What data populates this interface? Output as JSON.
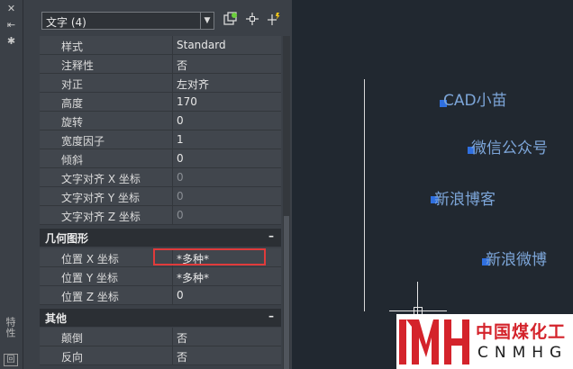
{
  "palette": {
    "close_glyph": "✕",
    "autohide_glyph": "⇤",
    "settings_glyph": "✱",
    "vertical_title": "特性"
  },
  "panel": {
    "selector": "文字 (4)",
    "rows": [
      {
        "label": "样式",
        "value": "Standard"
      },
      {
        "label": "注释性",
        "value": "否"
      },
      {
        "label": "对正",
        "value": "左对齐"
      },
      {
        "label": "高度",
        "value": "170"
      },
      {
        "label": "旋转",
        "value": "0"
      },
      {
        "label": "宽度因子",
        "value": "1"
      },
      {
        "label": "倾斜",
        "value": "0"
      },
      {
        "label": "文字对齐 X 坐标",
        "value": "0"
      },
      {
        "label": "文字对齐 Y 坐标",
        "value": "0"
      },
      {
        "label": "文字对齐 Z 坐标",
        "value": "0"
      }
    ],
    "geometry": {
      "title": "几何图形",
      "toggle": "–",
      "rows": [
        {
          "label": "位置 X 坐标",
          "value": "*多种*"
        },
        {
          "label": "位置 Y 坐标",
          "value": "*多种*"
        },
        {
          "label": "位置 Z 坐标",
          "value": "0"
        }
      ]
    },
    "misc": {
      "title": "其他",
      "toggle": "–",
      "rows": [
        {
          "label": "颠倒",
          "value": "否"
        },
        {
          "label": "反向",
          "value": "否"
        }
      ]
    }
  },
  "canvas": {
    "texts": [
      "CAD小苗",
      "微信公众号",
      "新浪博客",
      "新浪微博"
    ]
  },
  "watermark": {
    "cn": "中国煤化工",
    "en": "CNMHG",
    "colors": {
      "red": "#d4232b"
    }
  }
}
